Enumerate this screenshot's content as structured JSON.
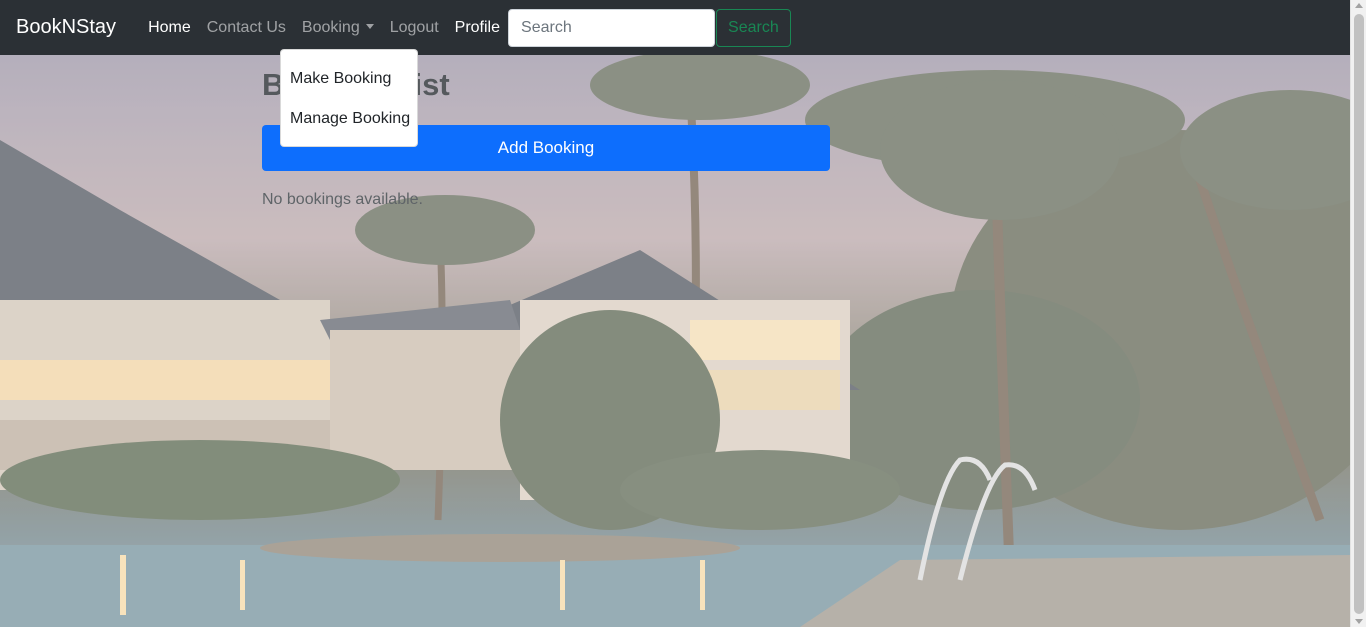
{
  "navbar": {
    "brand": "BookNStay",
    "links": {
      "home": "Home",
      "contact": "Contact Us",
      "booking": "Booking",
      "logout": "Logout",
      "profile": "Profile"
    },
    "search": {
      "placeholder": "Search",
      "value": "",
      "button_label": "Search"
    }
  },
  "dropdown": {
    "items": [
      "Make Booking",
      "Manage Booking"
    ]
  },
  "main": {
    "title": "Booking List",
    "add_button_label": "Add Booking",
    "empty_message": "No bookings available."
  },
  "colors": {
    "navbar_bg": "#2b3035",
    "primary": "#0d6efd",
    "success": "#198754"
  }
}
